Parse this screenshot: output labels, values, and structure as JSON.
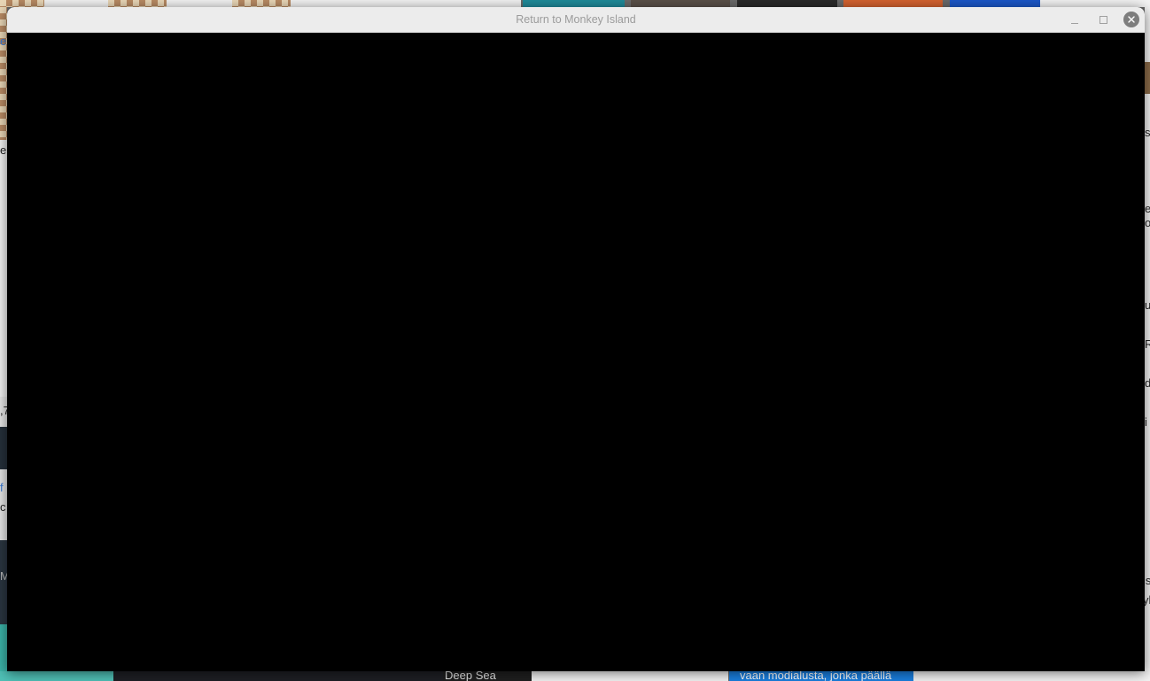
{
  "window": {
    "title": "Return to Monkey Island",
    "minimize_icon": "minimize-icon",
    "maximize_icon": "maximize-icon",
    "close_icon": "close-icon"
  },
  "background": {
    "right_edge_letters": [
      "s",
      "e",
      "o",
      "u",
      "R",
      "d",
      "i",
      "ls",
      "yl"
    ],
    "left_edge_letters": [
      "e",
      "e",
      ",7",
      "f",
      "c",
      "M"
    ],
    "bottom_caption": "Deep Sea",
    "bottom_highlight_text": "vaan modialusta, jonka päällä"
  }
}
